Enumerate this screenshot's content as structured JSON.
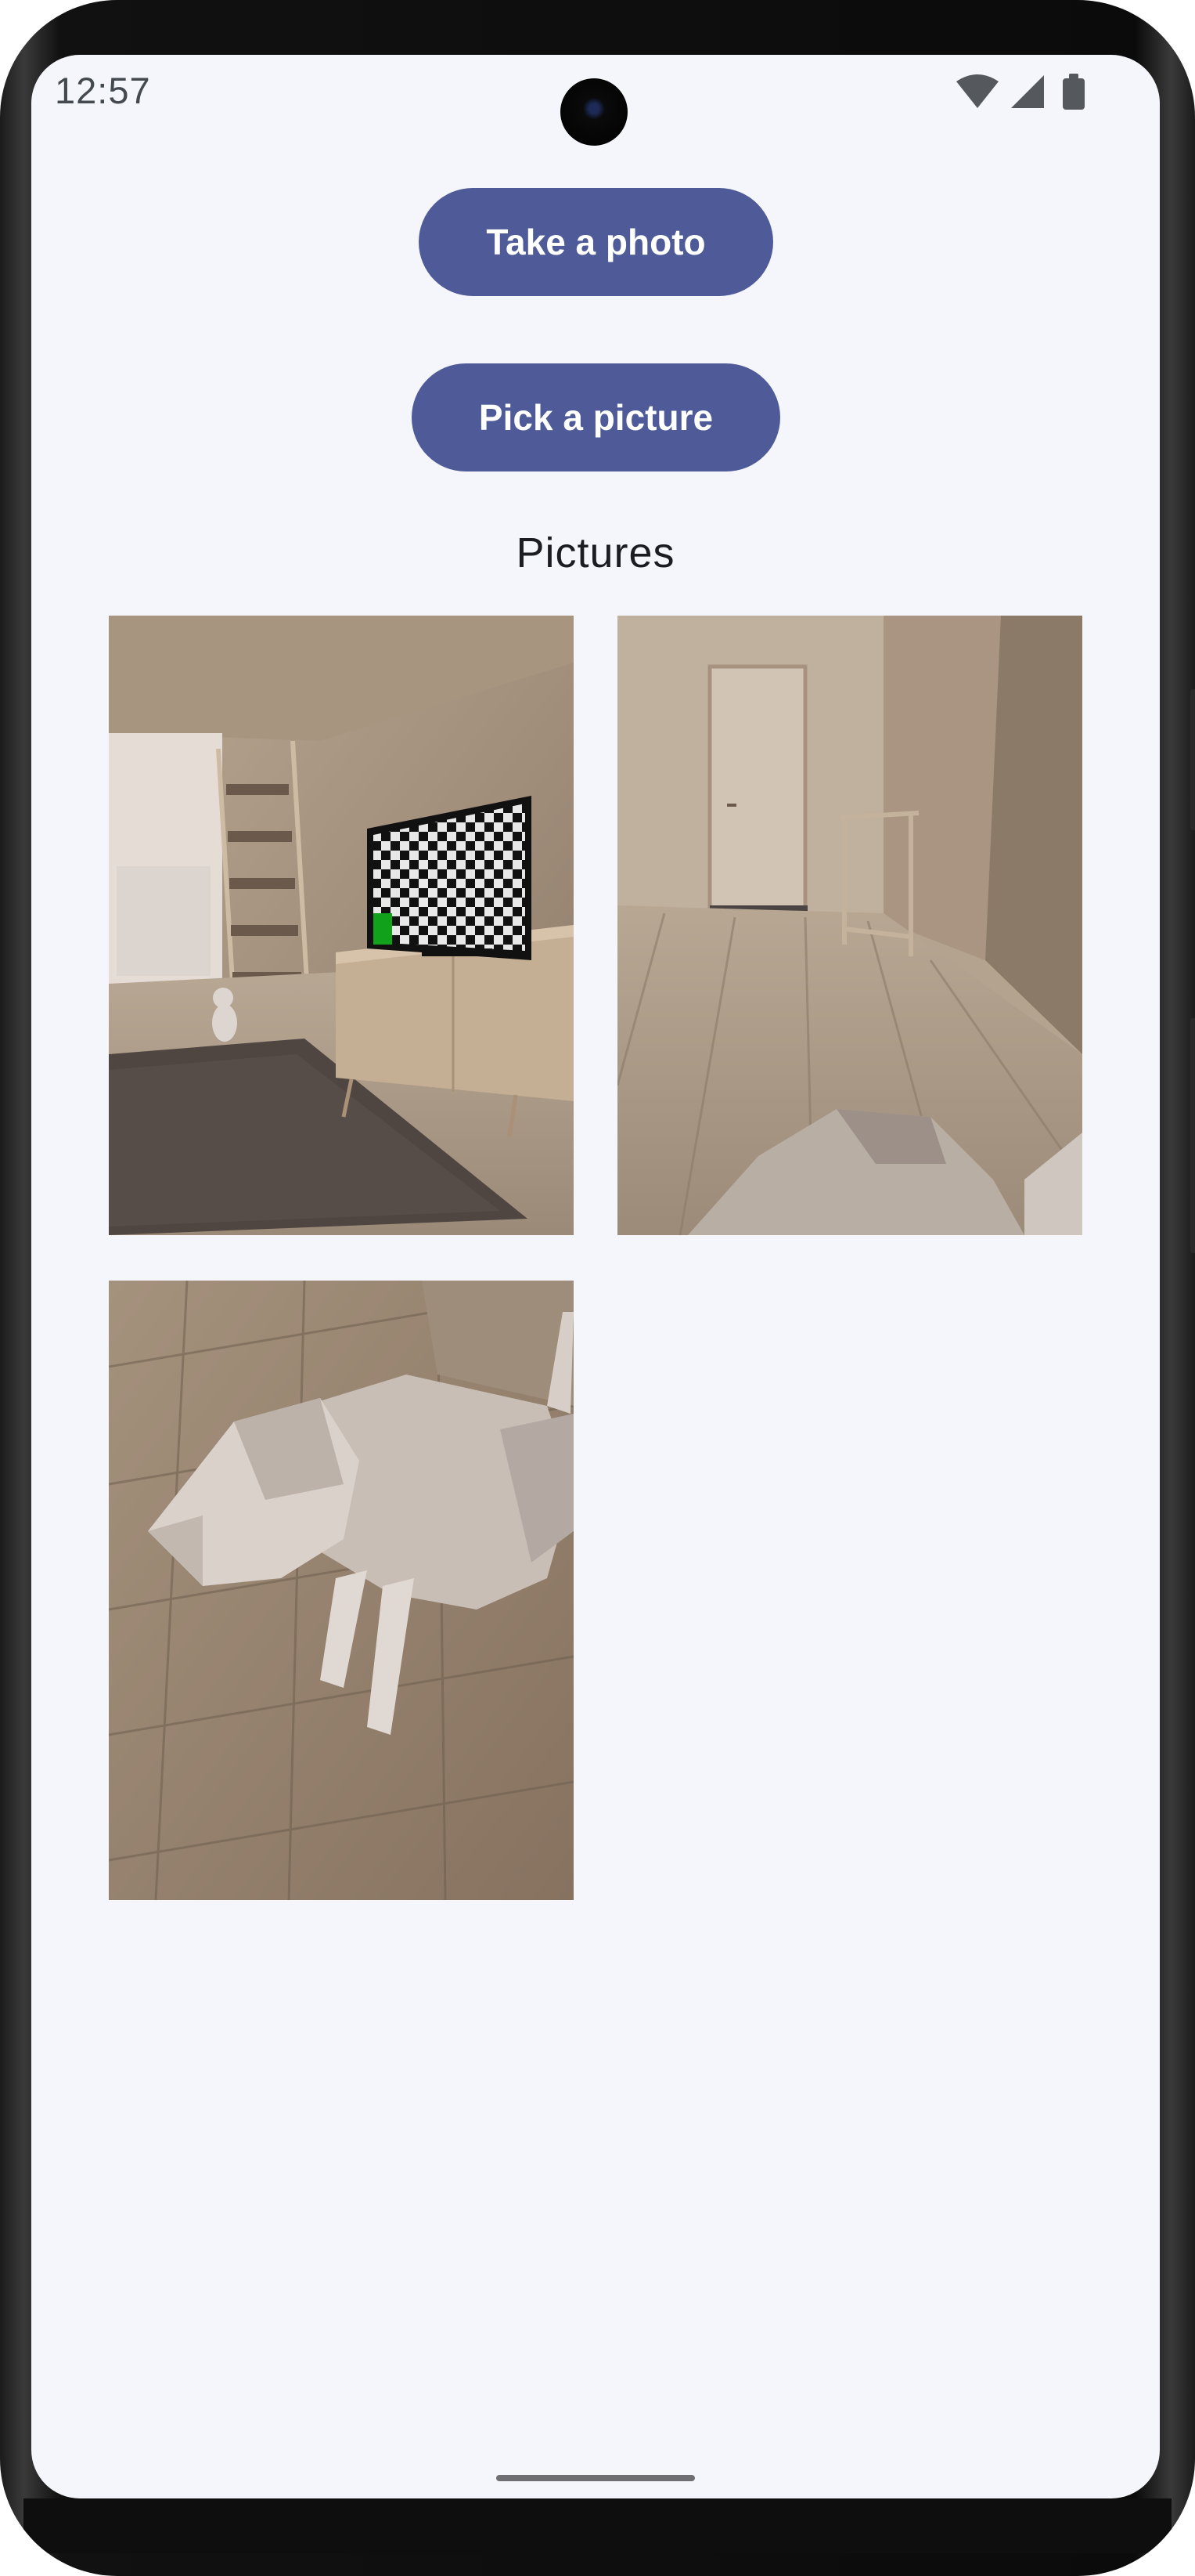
{
  "status_bar": {
    "time": "12:57",
    "icons": [
      "wifi-icon",
      "cell-signal-icon",
      "battery-icon"
    ]
  },
  "actions": {
    "take_photo_label": "Take a photo",
    "pick_picture_label": "Pick a picture"
  },
  "pictures": {
    "title": "Pictures",
    "items": [
      {
        "name": "living-room-tv-photo"
      },
      {
        "name": "hallway-door-photo"
      },
      {
        "name": "dog-figure-photo"
      }
    ]
  },
  "colors": {
    "button_bg": "#4e5b98",
    "button_text": "#ffffff",
    "screen_bg": "#f5f6fc",
    "title_text": "#1c1c22"
  }
}
